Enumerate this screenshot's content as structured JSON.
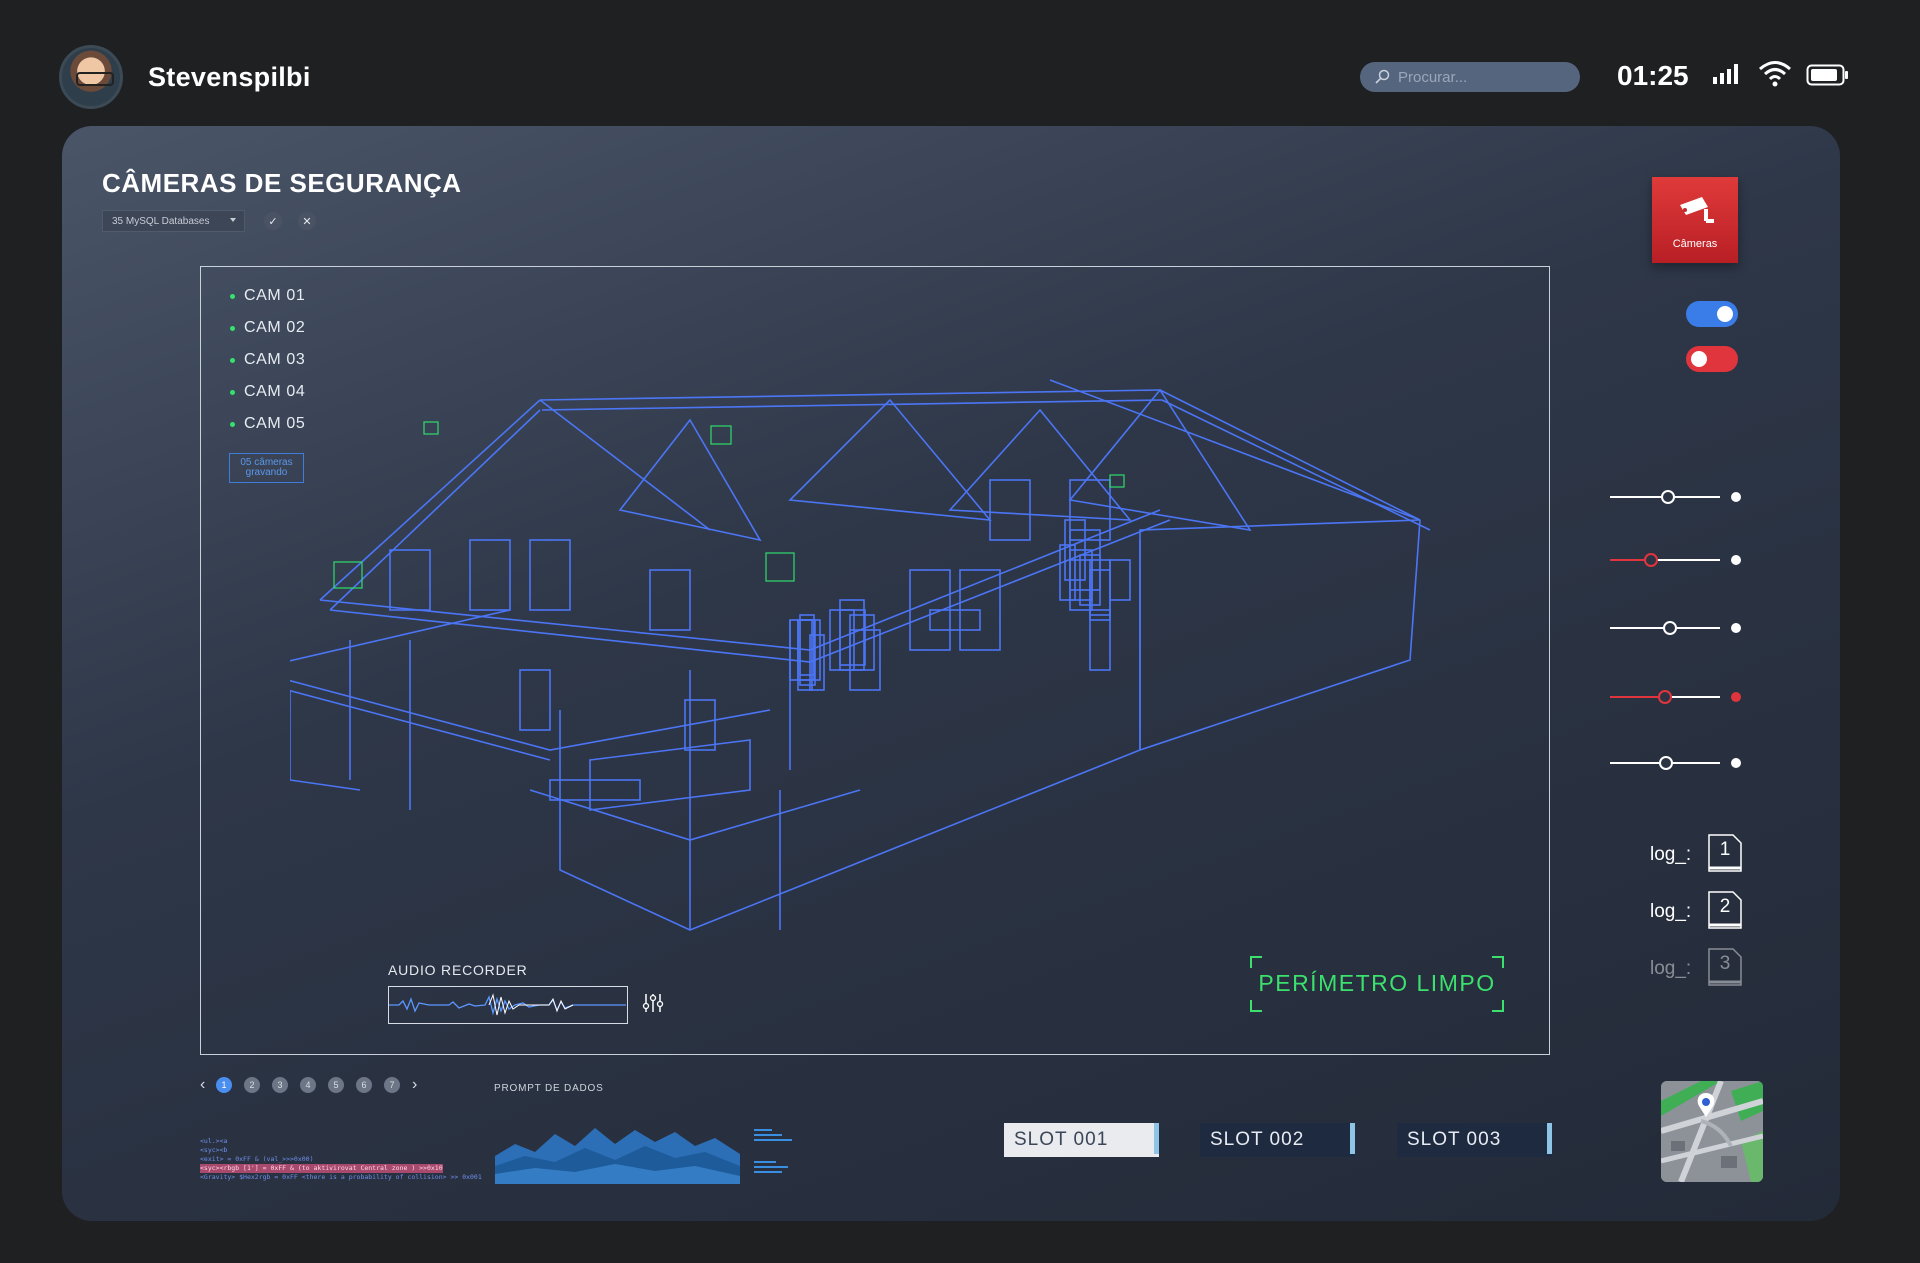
{
  "header": {
    "username": "Stevenspilbi",
    "search_placeholder": "Procurar...",
    "time": "01:25"
  },
  "page": {
    "title": "CÂMERAS DE SEGURANÇA",
    "db_select": "35 MySQL Databases",
    "confirm_icon": "check-icon",
    "cancel_icon": "close-icon"
  },
  "cameras": {
    "list": [
      "CAM 01",
      "CAM 02",
      "CAM 03",
      "CAM 04",
      "CAM 05"
    ],
    "recording_badge": "05 câmeras gravando",
    "audio_label": "AUDIO RECORDER",
    "perimeter_status": "PERÍMETRO LIMPO"
  },
  "side": {
    "camera_tile_label": "Câmeras",
    "toggles": [
      {
        "state": "on",
        "color": "#3b7de8"
      },
      {
        "state": "off",
        "color": "#e1353d"
      }
    ],
    "sliders": [
      {
        "value": 0.55,
        "color": "#ffffff",
        "dot_color": "#ffffff"
      },
      {
        "value": 0.38,
        "color": "#e1353d",
        "dot_color": "#ffffff"
      },
      {
        "value": 0.57,
        "color": "#ffffff",
        "dot_color": "#ffffff"
      },
      {
        "value": 0.52,
        "color": "#e1353d",
        "dot_color": "#e1353d"
      },
      {
        "value": 0.53,
        "color": "#ffffff",
        "dot_color": "#ffffff"
      }
    ],
    "logs": [
      {
        "label": "log_:",
        "number": "1"
      },
      {
        "label": "log_:",
        "number": "2"
      },
      {
        "label": "log_:",
        "number": "3"
      }
    ]
  },
  "bottom": {
    "pager": [
      "1",
      "2",
      "3",
      "4",
      "5",
      "6",
      "7"
    ],
    "pager_active": "1",
    "prompt_label": "PROMPT DE DADOS",
    "code_lines": [
      "<ul.><a",
      "<syc><b",
      "<exit> = 0xFF & (val_>>>0x00)",
      "<syc><rbgb [1'] = 0xFF & (to aktivirovat Central zone ) >>0x10",
      "<Gravity> $Hex2rgb = 0xFF <there is a probability of collision> >> 0x001"
    ],
    "slots": [
      "SLOT  001",
      "SLOT  002",
      "SLOT  003"
    ]
  },
  "colors": {
    "accent_blue": "#3b7de8",
    "accent_red": "#e1353d",
    "status_green": "#3be06d",
    "wireframe": "#4d79ff"
  }
}
